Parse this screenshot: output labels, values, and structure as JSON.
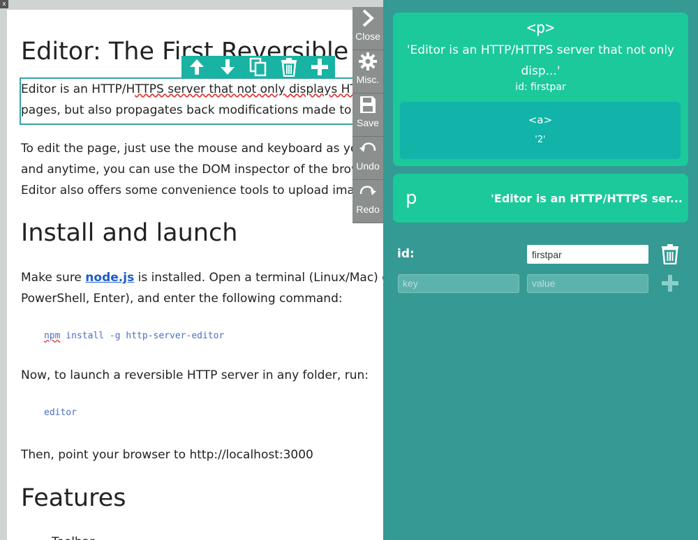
{
  "window": {
    "close_label": "x"
  },
  "editor": {
    "h1_title": "Editor: The First Reversible HTTP/HTTPS Server",
    "para1_a": "Editor is an HTTP/H",
    "para1_b": "TTPS server that not only displays HTML (.html), Markdown (.md) and Elm (.elm)",
    "para1_c": "pages, but also propagates back modifications made to the pages to the files.",
    "para2_line1": "To edit the page, just use the mouse and keyboard as you would in a word processor. Anywhere",
    "para2_line2": "and anytime, you can use the DOM inspector of the browser of your choice to modify the source page.",
    "para2_line3": "Editor also offers some convenience tools to upload images and create/modify links.",
    "h2_install": "Install and launch",
    "install_a": "Make sure ",
    "install_link": "node.js",
    "install_b": " is installed. Open a terminal (Linux/Mac) or PowerShell (Windows: WIN+R,",
    "install_c": "PowerShell, Enter), and enter the following command:",
    "cmd_npm": "npm",
    "cmd_rest": " install -g http-server-editor",
    "launch_text": "Now, to launch a reversible HTTP server in any folder, run:",
    "cmd_editor": "editor",
    "point_text": "Then, point your browser to http://localhost:3000",
    "h2_features": "Features",
    "feature_cut": "Toolbar"
  },
  "toolbar": {
    "up_icon": "arrow-up",
    "down_icon": "arrow-down",
    "copy_icon": "copy",
    "delete_icon": "trash",
    "add_icon": "plus"
  },
  "sidebar": {
    "close_label": "Close",
    "misc_label": "Misc.",
    "save_label": "Save",
    "undo_label": "Undo",
    "redo_label": "Redo"
  },
  "panel": {
    "card1_tag": "<p>",
    "card1_text": "'Editor is an HTTP/HTTPS server that not only disp...'",
    "card1_id": "id: firstpar",
    "sub_tag": "<a>",
    "sub_text": "'2'",
    "card2_tag": "p",
    "card2_text": "'Editor is an HTTP/HTTPS ser...",
    "attr_label": "id:",
    "attr_value": "firstpar",
    "key_placeholder": "key",
    "value_placeholder": "value"
  },
  "colors": {
    "panel_bg": "#349a93",
    "card_bg": "#1bc99b",
    "toolbar_bg": "#18b3a3",
    "link": "#1a5ec9"
  }
}
